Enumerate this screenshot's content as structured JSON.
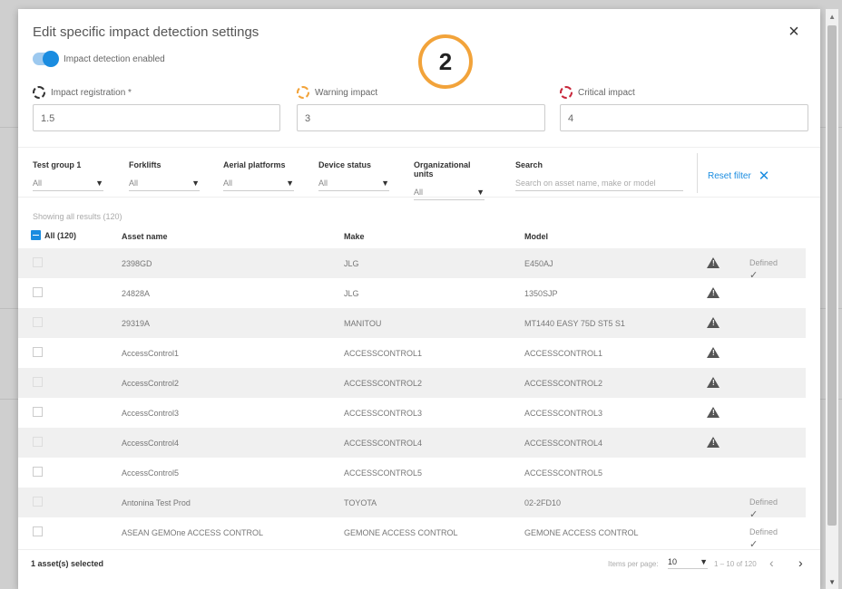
{
  "dialog": {
    "title": "Edit specific impact detection settings",
    "close_icon": "×",
    "step_badge": "2"
  },
  "toggle": {
    "label": "Impact detection enabled",
    "enabled": true
  },
  "thresholds": [
    {
      "label": "Impact registration *",
      "value": "1.5",
      "icon": "impact-circle-icon",
      "color": "#333333"
    },
    {
      "label": "Warning impact",
      "value": "3",
      "icon": "warning-circle-icon",
      "color": "#f2a33a"
    },
    {
      "label": "Critical impact",
      "value": "4",
      "icon": "critical-circle-icon",
      "color": "#c8283c"
    }
  ],
  "filters": [
    {
      "label": "Test group 1",
      "value": "All"
    },
    {
      "label": "Forklifts",
      "value": "All"
    },
    {
      "label": "Aerial platforms",
      "value": "All"
    },
    {
      "label": "Device status",
      "value": "All"
    },
    {
      "label": "Organizational units",
      "value": "All"
    }
  ],
  "search": {
    "label": "Search",
    "placeholder": "Search on asset name, make or model"
  },
  "reset_filter": {
    "label": "Reset filter",
    "icon": "✕"
  },
  "results_text": "Showing all results (120)",
  "table": {
    "all_label": "All (120)",
    "columns": [
      "Asset name",
      "Make",
      "Model"
    ],
    "rows": [
      {
        "name": "2398GD",
        "make": "JLG",
        "model": "E450AJ",
        "warning": true,
        "defined": true
      },
      {
        "name": "24828A",
        "make": "JLG",
        "model": "1350SJP",
        "warning": true,
        "defined": false
      },
      {
        "name": "29319A",
        "make": "MANITOU",
        "model": "MT1440 EASY 75D ST5 S1",
        "warning": true,
        "defined": false
      },
      {
        "name": "AccessControl1",
        "make": "ACCESSCONTROL1",
        "model": "ACCESSCONTROL1",
        "warning": true,
        "defined": false
      },
      {
        "name": "AccessControl2",
        "make": "ACCESSCONTROL2",
        "model": "ACCESSCONTROL2",
        "warning": true,
        "defined": false
      },
      {
        "name": "AccessControl3",
        "make": "ACCESSCONTROL3",
        "model": "ACCESSCONTROL3",
        "warning": true,
        "defined": false
      },
      {
        "name": "AccessControl4",
        "make": "ACCESSCONTROL4",
        "model": "ACCESSCONTROL4",
        "warning": true,
        "defined": false
      },
      {
        "name": "AccessControl5",
        "make": "ACCESSCONTROL5",
        "model": "ACCESSCONTROL5",
        "warning": false,
        "defined": false
      },
      {
        "name": "Antonina Test Prod",
        "make": "TOYOTA",
        "model": "02-2FD10",
        "warning": false,
        "defined": true
      },
      {
        "name": "ASEAN GEMOne ACCESS CONTROL",
        "make": "GEMONE ACCESS CONTROL",
        "model": "GEMONE ACCESS CONTROL",
        "warning": false,
        "defined": true
      }
    ],
    "defined_label": "Defined"
  },
  "footer": {
    "selected": "1 asset(s) selected",
    "items_per_page_label": "Items per page:",
    "items_per_page": "10",
    "range": "1 – 10 of 120"
  },
  "colors": {
    "accent": "#1a8ce0",
    "badge": "#f2a33a"
  }
}
